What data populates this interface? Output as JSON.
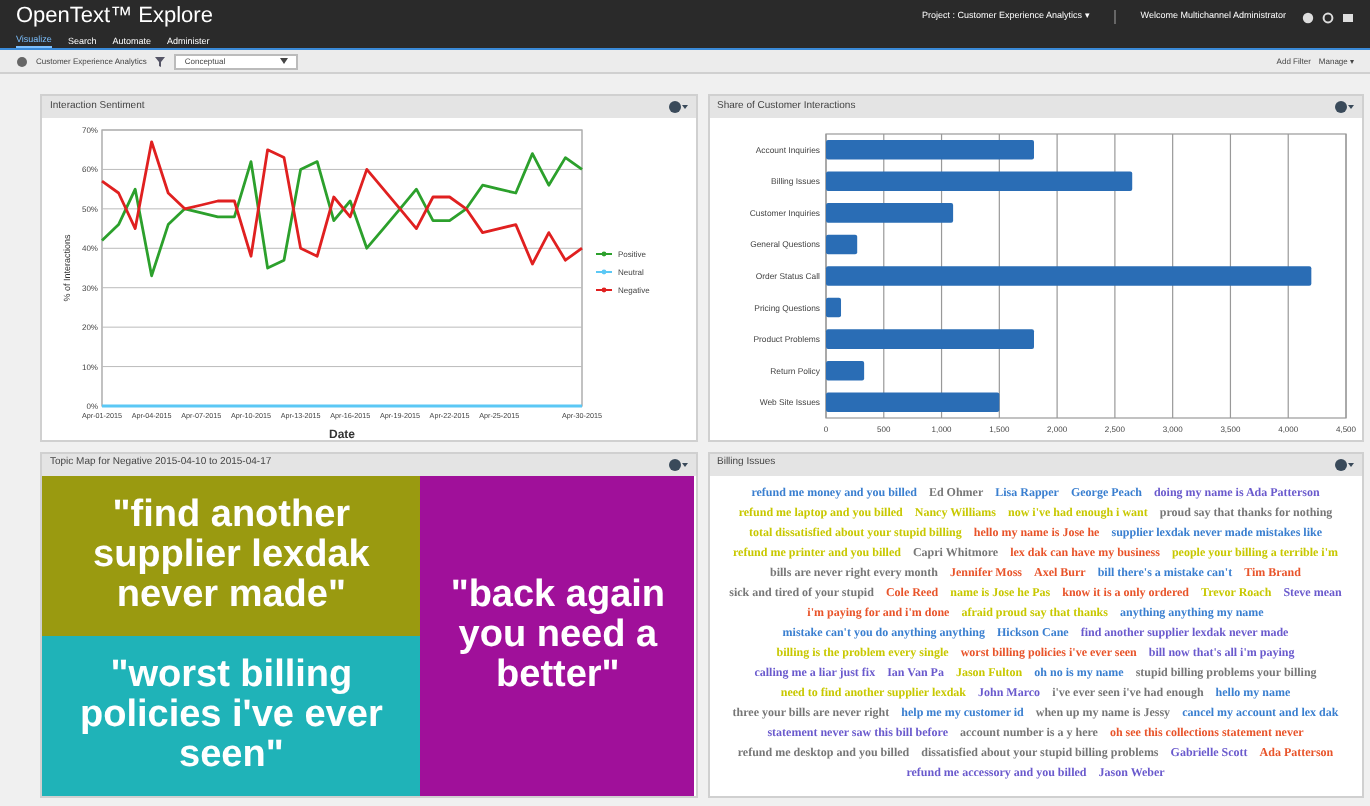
{
  "header": {
    "title": "OpenText™ Explore",
    "project": "Project : Customer Experience Analytics ▾",
    "welcome": "Welcome Multichannel Administrator"
  },
  "tabs": [
    {
      "label": "Visualize",
      "selected": true
    },
    {
      "label": "Search",
      "selected": false
    },
    {
      "label": "Automate",
      "selected": false
    },
    {
      "label": "Administer",
      "selected": false
    }
  ],
  "toolbar": {
    "source": "Customer Experience Analytics",
    "view": "Conceptual",
    "add_filter": "Add Filter",
    "manage": "Manage ▾"
  },
  "sentiment_panel": {
    "title": "Interaction Sentiment",
    "chart_data": {
      "type": "line",
      "xlabel": "Date",
      "ylabel": "% of Interactions",
      "grid": true,
      "legend": true,
      "categories": [
        "Apr-01-2015",
        null,
        null,
        "Apr-04-2015",
        null,
        null,
        "Apr-07-2015",
        null,
        null,
        "Apr-10-2015",
        null,
        null,
        "Apr-13-2015",
        null,
        null,
        "Apr-16-2015",
        null,
        null,
        "Apr-19-2015",
        null,
        null,
        "Apr-22-2015",
        null,
        null,
        "Apr-25-2015",
        null,
        null,
        null,
        null,
        "Apr-30-2015"
      ],
      "yticks": [
        {
          "value": 0,
          "label": "0%"
        },
        {
          "value": 10,
          "label": "10%"
        },
        {
          "value": 20,
          "label": "20%"
        },
        {
          "value": 30,
          "label": "30%"
        },
        {
          "value": 40,
          "label": "40%"
        },
        {
          "value": 50,
          "label": "50%"
        },
        {
          "value": 60,
          "label": "60%"
        },
        {
          "value": 70,
          "label": "70%"
        }
      ],
      "ylim": [
        0,
        70
      ],
      "series": [
        {
          "name": "Positive",
          "color": "#2ca02c",
          "values": [
            42,
            46,
            55,
            33,
            46,
            50,
            49,
            48,
            48,
            62,
            35,
            37,
            60,
            62,
            47,
            52,
            40,
            45,
            50,
            55,
            47,
            47,
            50,
            56,
            55,
            54,
            64,
            56,
            63,
            60
          ]
        },
        {
          "name": "Neutral",
          "color": "#5bc8f5",
          "values": [
            0,
            0,
            0,
            0,
            0,
            0,
            0,
            0,
            0,
            0,
            0,
            0,
            0,
            0,
            0,
            0,
            0,
            0,
            0,
            0,
            0,
            0,
            0,
            0,
            0,
            0,
            0,
            0,
            0,
            0
          ]
        },
        {
          "name": "Negative",
          "color": "#e02020",
          "values": [
            57,
            54,
            45,
            67,
            54,
            50,
            51,
            52,
            52,
            38,
            65,
            63,
            40,
            38,
            53,
            48,
            60,
            55,
            50,
            45,
            53,
            53,
            50,
            44,
            45,
            46,
            36,
            44,
            37,
            40
          ]
        }
      ]
    }
  },
  "interactions_panel": {
    "title": "Share of Customer Interactions",
    "chart_data": {
      "type": "bar",
      "orientation": "horizontal",
      "categories": [
        "Account Inquiries",
        "Billing Issues",
        "Customer Inquiries",
        "General Questions",
        "Order Status Call",
        "Pricing Questions",
        "Product Problems",
        "Return Policy",
        "Web Site Issues"
      ],
      "values": [
        1800,
        2650,
        1100,
        270,
        4200,
        130,
        1800,
        330,
        1500
      ],
      "xlim": [
        0,
        4500
      ],
      "grid": true,
      "xticks": [
        {
          "value": 0,
          "label": "0"
        },
        {
          "value": 500,
          "label": "500"
        },
        {
          "value": 1000,
          "label": "1,000"
        },
        {
          "value": 1500,
          "label": "1,500"
        },
        {
          "value": 2000,
          "label": "2,000"
        },
        {
          "value": 2500,
          "label": "2,500"
        },
        {
          "value": 3000,
          "label": "3,000"
        },
        {
          "value": 3500,
          "label": "3,500"
        },
        {
          "value": 4000,
          "label": "4,000"
        },
        {
          "value": 4500,
          "label": "4,500"
        }
      ]
    }
  },
  "topic_panel": {
    "title": "Topic Map for Negative 2015-04-10 to 2015-04-17",
    "tiles": [
      {
        "text": "\"find another supplier lexdak never made\"",
        "color": "#9a9a10"
      },
      {
        "text": "\"worst billing policies i've ever seen\"",
        "color": "#1fb3b8"
      },
      {
        "text": "\"back again you need a better\"",
        "color": "#a0109a"
      }
    ]
  },
  "billing_panel": {
    "title": "Billing Issues",
    "words": [
      {
        "text": "refund me money and you billed",
        "color": "#3a7fd0"
      },
      {
        "text": "Ed Ohmer",
        "color": "#777777"
      },
      {
        "text": "Lisa Rapper",
        "color": "#3a7fd0"
      },
      {
        "text": "George Peach",
        "color": "#3a7fd0"
      },
      {
        "text": "doing my name is Ada Patterson",
        "color": "#6a5acd"
      },
      {
        "text": "refund me laptop and you billed",
        "color": "#c8c800"
      },
      {
        "text": "Nancy Williams",
        "color": "#c8c800"
      },
      {
        "text": "now i've had enough i want",
        "color": "#c8c800"
      },
      {
        "text": "proud say that thanks for nothing",
        "color": "#777777"
      },
      {
        "text": "total dissatisfied about your stupid billing",
        "color": "#c8c800"
      },
      {
        "text": "hello my name is Jose he",
        "color": "#e8542a"
      },
      {
        "text": "supplier lexdak never made mistakes like",
        "color": "#3a7fd0"
      },
      {
        "text": "refund me printer and you billed",
        "color": "#c8c800"
      },
      {
        "text": "Capri Whitmore",
        "color": "#777777"
      },
      {
        "text": "lex dak can have my business",
        "color": "#e8542a"
      },
      {
        "text": "people your billing a terrible i'm",
        "color": "#c8c800"
      },
      {
        "text": "bills are never right every month",
        "color": "#777777"
      },
      {
        "text": "Jennifer Moss",
        "color": "#e8542a"
      },
      {
        "text": "Axel Burr",
        "color": "#e8542a"
      },
      {
        "text": "bill there's a mistake can't",
        "color": "#3a7fd0"
      },
      {
        "text": "Tim Brand",
        "color": "#e8542a"
      },
      {
        "text": "sick and tired of your stupid",
        "color": "#777777"
      },
      {
        "text": "Cole Reed",
        "color": "#e8542a"
      },
      {
        "text": "name is Jose he Pas",
        "color": "#c8c800"
      },
      {
        "text": "know it is a only ordered",
        "color": "#e8542a"
      },
      {
        "text": "Trevor Roach",
        "color": "#c8c800"
      },
      {
        "text": "Steve mean",
        "color": "#6a5acd"
      },
      {
        "text": "i'm paying for and i'm done",
        "color": "#e8542a"
      },
      {
        "text": "afraid proud say that thanks",
        "color": "#c8c800"
      },
      {
        "text": "anything anything my name",
        "color": "#3a7fd0"
      },
      {
        "text": "mistake can't you do anything anything",
        "color": "#3a7fd0"
      },
      {
        "text": "Hickson Cane",
        "color": "#3a7fd0"
      },
      {
        "text": "find another supplier lexdak never made",
        "color": "#6a5acd"
      },
      {
        "text": "billing is the problem every single",
        "color": "#c8c800"
      },
      {
        "text": "worst billing policies i've ever seen",
        "color": "#e8542a"
      },
      {
        "text": "bill now that's all i'm paying",
        "color": "#6a5acd"
      },
      {
        "text": "calling me a liar just fix",
        "color": "#6a5acd"
      },
      {
        "text": "Ian Van Pa",
        "color": "#6a5acd"
      },
      {
        "text": "Jason Fulton",
        "color": "#c8c800"
      },
      {
        "text": "oh no is my name",
        "color": "#3a7fd0"
      },
      {
        "text": "stupid billing problems your billing",
        "color": "#777777"
      },
      {
        "text": "need to find another supplier lexdak",
        "color": "#c8c800"
      },
      {
        "text": "John Marco",
        "color": "#6a5acd"
      },
      {
        "text": "i've ever seen i've had enough",
        "color": "#777777"
      },
      {
        "text": "hello my name",
        "color": "#3a7fd0"
      },
      {
        "text": "three your bills are never right",
        "color": "#777777"
      },
      {
        "text": "help me my customer id",
        "color": "#3a7fd0"
      },
      {
        "text": "when up my name is Jessy",
        "color": "#777777"
      },
      {
        "text": "cancel my account and lex dak",
        "color": "#3a7fd0"
      },
      {
        "text": "statement never saw this bill before",
        "color": "#6a5acd"
      },
      {
        "text": "account number is a y here",
        "color": "#777777"
      },
      {
        "text": "oh see this collections statement never",
        "color": "#e8542a"
      },
      {
        "text": "refund me desktop and you billed",
        "color": "#777777"
      },
      {
        "text": "dissatisfied about your stupid billing problems",
        "color": "#777777"
      },
      {
        "text": "Gabrielle Scott",
        "color": "#6a5acd"
      },
      {
        "text": "Ada Patterson",
        "color": "#e8542a"
      },
      {
        "text": "refund me accessory and you billed",
        "color": "#6a5acd"
      },
      {
        "text": "Jason Weber",
        "color": "#6a5acd"
      }
    ]
  }
}
